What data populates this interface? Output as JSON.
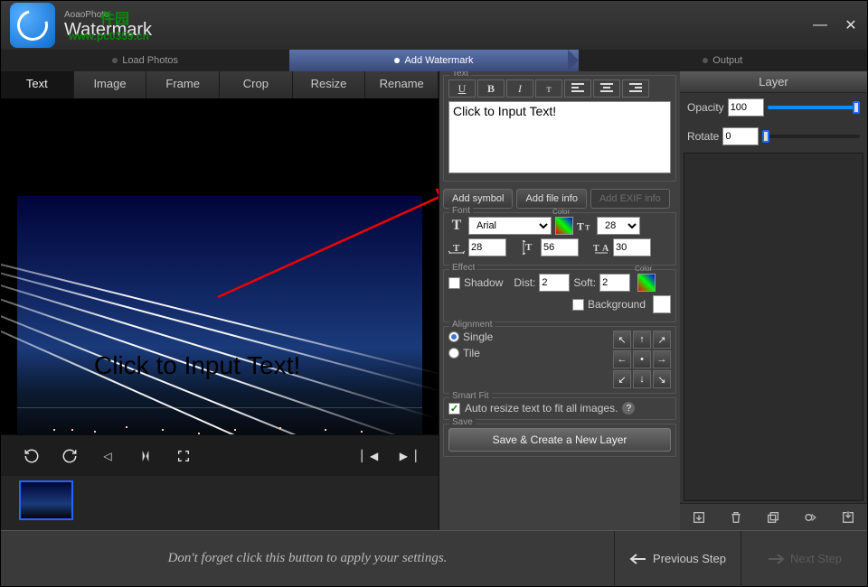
{
  "app": {
    "brand_small": "AoaoPhoto",
    "title": "Watermark",
    "ghost1": "www.pc0359.cn",
    "ghost2": "件园"
  },
  "steps": {
    "load": "Load Photos",
    "add": "Add Watermark",
    "output": "Output"
  },
  "subtabs": {
    "text": "Text",
    "image": "Image",
    "frame": "Frame",
    "crop": "Crop",
    "resize": "Resize",
    "rename": "Rename"
  },
  "preview": {
    "overlay_text": "Click to Input Text!"
  },
  "text_panel": {
    "legend": "Text",
    "content": "Click to Input Text!",
    "add_symbol": "Add symbol",
    "add_file_info": "Add file info",
    "add_exif": "Add EXIF info"
  },
  "font_panel": {
    "legend": "Font",
    "font_name": "Arial",
    "size": 28,
    "v1": 28,
    "v2": 56,
    "v3": 30
  },
  "effect_panel": {
    "legend": "Effect",
    "shadow_label": "Shadow",
    "dist_label": "Dist:",
    "dist": 2,
    "soft_label": "Soft:",
    "soft": 2,
    "background_label": "Background"
  },
  "align_panel": {
    "legend": "Alignment",
    "single": "Single",
    "tile": "Tile"
  },
  "smart_panel": {
    "legend": "Smart Fit",
    "auto_text": "Auto resize text to fit all images."
  },
  "save_panel": {
    "legend": "Save",
    "button": "Save & Create a New Layer"
  },
  "layer_panel": {
    "title": "Layer",
    "opacity_label": "Opacity",
    "opacity": 100,
    "rotate_label": "Rotate",
    "rotate": 0
  },
  "footer": {
    "hint": "Don't forget click this button to apply your settings.",
    "prev": "Previous Step",
    "next": "Next Step"
  }
}
